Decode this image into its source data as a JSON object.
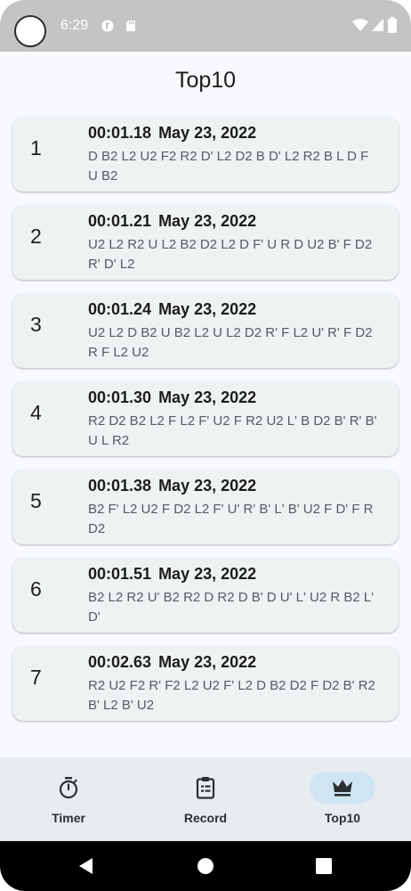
{
  "status_bar": {
    "time": "6:29"
  },
  "header": {
    "title": "Top10"
  },
  "records": [
    {
      "rank": "1",
      "time": "00:01.18",
      "date": "May 23, 2022",
      "scramble": "D B2 L2 U2 F2 R2 D' L2 D2 B D' L2 R2 B L D F U B2"
    },
    {
      "rank": "2",
      "time": "00:01.21",
      "date": "May 23, 2022",
      "scramble": "U2 L2 R2 U L2 B2 D2 L2 D F' U R D U2 B' F D2 R' D' L2"
    },
    {
      "rank": "3",
      "time": "00:01.24",
      "date": "May 23, 2022",
      "scramble": "U2 L2 D B2 U B2 L2 U L2 D2 R' F L2 U' R' F D2 R F L2 U2"
    },
    {
      "rank": "4",
      "time": "00:01.30",
      "date": "May 23, 2022",
      "scramble": "R2 D2 B2 L2 F L2 F' U2 F R2 U2 L' B D2 B' R' B' U L R2"
    },
    {
      "rank": "5",
      "time": "00:01.38",
      "date": "May 23, 2022",
      "scramble": "B2 F' L2 U2 F D2 L2 F' U' R' B' L' B' U2 F D' F R D2"
    },
    {
      "rank": "6",
      "time": "00:01.51",
      "date": "May 23, 2022",
      "scramble": "B2 L2 R2 U' B2 R2 D R2 D B' D U' L' U2 R B2 L' D'"
    },
    {
      "rank": "7",
      "time": "00:02.63",
      "date": "May 23, 2022",
      "scramble": "R2 U2 F2 R' F2 L2 U2 F' L2 D B2 D2 F D2 B' R2 B' L2 B' U2"
    }
  ],
  "bottom_nav": {
    "items": [
      {
        "label": "Timer",
        "icon": "stopwatch-icon",
        "active": false
      },
      {
        "label": "Record",
        "icon": "clipboard-icon",
        "active": false
      },
      {
        "label": "Top10",
        "icon": "crown-icon",
        "active": true
      }
    ]
  },
  "system_nav": {
    "back_icon": "back-triangle-icon",
    "home_icon": "home-circle-icon",
    "recents_icon": "recents-square-icon"
  },
  "colors": {
    "status_bar": "#c4c4c4",
    "background": "#f8f9fc",
    "card": "#eef2f3",
    "bottom_nav": "#e7ecf1",
    "active_indicator": "#cfe5f2",
    "system_nav": "#000000"
  }
}
